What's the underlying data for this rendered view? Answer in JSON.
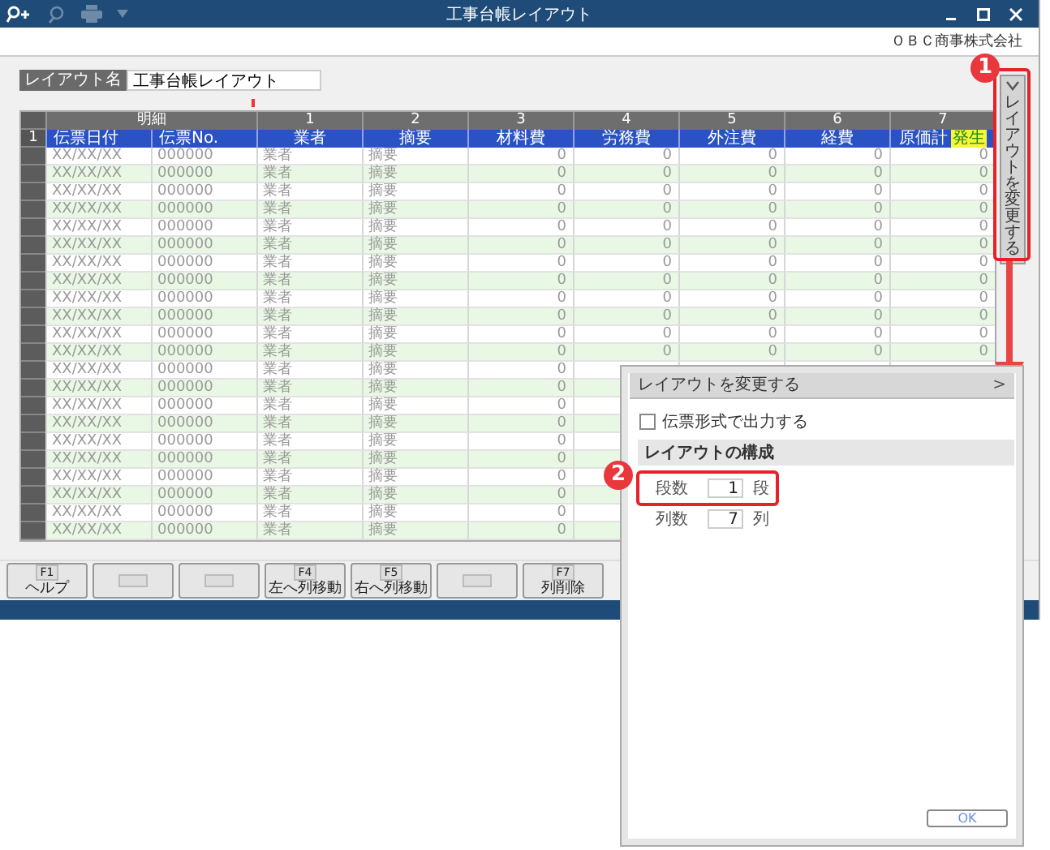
{
  "window": {
    "title": "工事台帳レイアウト",
    "company": "ＯＢＣ商事株式会社"
  },
  "layout_name": {
    "label": "レイアウト名",
    "value": "工事台帳レイアウト"
  },
  "table": {
    "group_headers": [
      "明細",
      "1",
      "2",
      "3",
      "4",
      "5",
      "6",
      "7"
    ],
    "row_number": "1",
    "columns": [
      "伝票日付",
      "伝票No.",
      "業者",
      "摘要",
      "材料費",
      "労務費",
      "外注費",
      "経費",
      "原価計"
    ],
    "tag": "発生",
    "rows": [
      [
        "XX/XX/XX",
        "000000",
        "業者",
        "摘要",
        "0",
        "0",
        "0",
        "0",
        "0"
      ],
      [
        "XX/XX/XX",
        "000000",
        "業者",
        "摘要",
        "0",
        "0",
        "0",
        "0",
        "0"
      ],
      [
        "XX/XX/XX",
        "000000",
        "業者",
        "摘要",
        "0",
        "0",
        "0",
        "0",
        "0"
      ],
      [
        "XX/XX/XX",
        "000000",
        "業者",
        "摘要",
        "0",
        "0",
        "0",
        "0",
        "0"
      ],
      [
        "XX/XX/XX",
        "000000",
        "業者",
        "摘要",
        "0",
        "0",
        "0",
        "0",
        "0"
      ],
      [
        "XX/XX/XX",
        "000000",
        "業者",
        "摘要",
        "0",
        "0",
        "0",
        "0",
        "0"
      ],
      [
        "XX/XX/XX",
        "000000",
        "業者",
        "摘要",
        "0",
        "0",
        "0",
        "0",
        "0"
      ],
      [
        "XX/XX/XX",
        "000000",
        "業者",
        "摘要",
        "0",
        "0",
        "0",
        "0",
        "0"
      ],
      [
        "XX/XX/XX",
        "000000",
        "業者",
        "摘要",
        "0",
        "0",
        "0",
        "0",
        "0"
      ],
      [
        "XX/XX/XX",
        "000000",
        "業者",
        "摘要",
        "0",
        "0",
        "0",
        "0",
        "0"
      ],
      [
        "XX/XX/XX",
        "000000",
        "業者",
        "摘要",
        "0",
        "0",
        "0",
        "0",
        "0"
      ],
      [
        "XX/XX/XX",
        "000000",
        "業者",
        "摘要",
        "0",
        "0",
        "0",
        "0",
        "0"
      ],
      [
        "XX/XX/XX",
        "000000",
        "業者",
        "摘要",
        "0"
      ],
      [
        "XX/XX/XX",
        "000000",
        "業者",
        "摘要",
        "0"
      ],
      [
        "XX/XX/XX",
        "000000",
        "業者",
        "摘要",
        "0"
      ],
      [
        "XX/XX/XX",
        "000000",
        "業者",
        "摘要",
        "0"
      ],
      [
        "XX/XX/XX",
        "000000",
        "業者",
        "摘要",
        "0"
      ],
      [
        "XX/XX/XX",
        "000000",
        "業者",
        "摘要",
        "0"
      ],
      [
        "XX/XX/XX",
        "000000",
        "業者",
        "摘要",
        "0"
      ],
      [
        "XX/XX/XX",
        "000000",
        "業者",
        "摘要",
        "0"
      ],
      [
        "XX/XX/XX",
        "000000",
        "業者",
        "摘要",
        "0"
      ],
      [
        "XX/XX/XX",
        "000000",
        "業者",
        "摘要",
        "0"
      ]
    ]
  },
  "function_keys": [
    {
      "kind": "key",
      "key": "F1",
      "label": "ヘルプ"
    },
    {
      "kind": "blank"
    },
    {
      "kind": "blank"
    },
    {
      "kind": "key",
      "key": "F4",
      "label": "左へ列移動"
    },
    {
      "kind": "key",
      "key": "F5",
      "label": "右へ列移動"
    },
    {
      "kind": "blank"
    },
    {
      "kind": "key",
      "key": "F7",
      "label": "列削除"
    }
  ],
  "side_tab": {
    "label": "レイアウトを変更する"
  },
  "panel": {
    "title": "レイアウトを変更する",
    "collapse": ">",
    "checkbox": {
      "label": "伝票形式で出力する",
      "checked": false
    },
    "section": "レイアウトの構成",
    "fields": [
      {
        "label": "段数",
        "value": "1",
        "unit": "段"
      },
      {
        "label": "列数",
        "value": "7",
        "unit": "列"
      }
    ],
    "ok": "OK"
  },
  "callouts": [
    "1",
    "2"
  ]
}
